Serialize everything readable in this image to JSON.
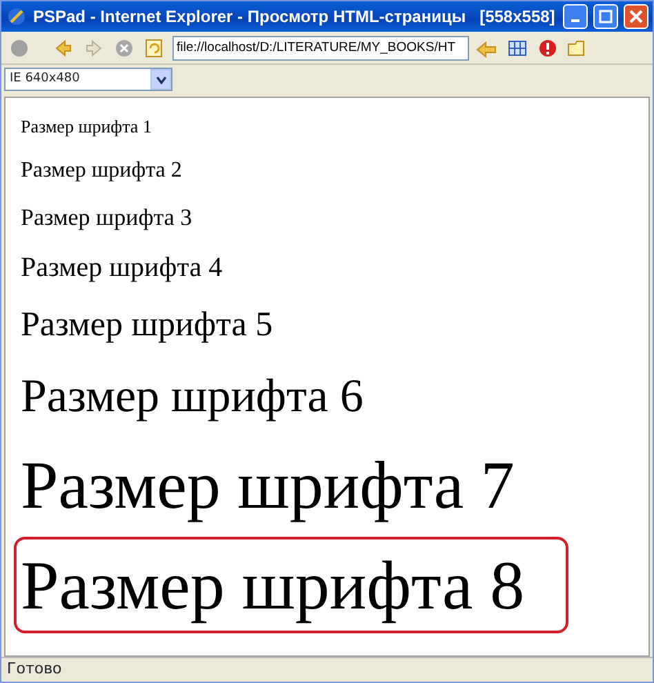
{
  "window": {
    "title": "PSPad - Internet Explorer - Просмотр HTML-страницы   [558x558]"
  },
  "toolbar": {
    "address": "file://localhost/D:/LITERATURE/MY_BOOKS/HT"
  },
  "view_select": {
    "value": "IE 640x480"
  },
  "lines": [
    {
      "text": "Размер шрифта 1",
      "highlighted": false
    },
    {
      "text": "Размер шрифта 2",
      "highlighted": false
    },
    {
      "text": "Размер шрифта 3",
      "highlighted": false
    },
    {
      "text": "Размер шрифта 4",
      "highlighted": false
    },
    {
      "text": "Размер шрифта 5",
      "highlighted": false
    },
    {
      "text": "Размер шрифта 6",
      "highlighted": false
    },
    {
      "text": "Размер шрифта 7",
      "highlighted": false
    },
    {
      "text": "Размер шрифта 8",
      "highlighted": true
    }
  ],
  "status_bar": {
    "text": "Готово"
  }
}
